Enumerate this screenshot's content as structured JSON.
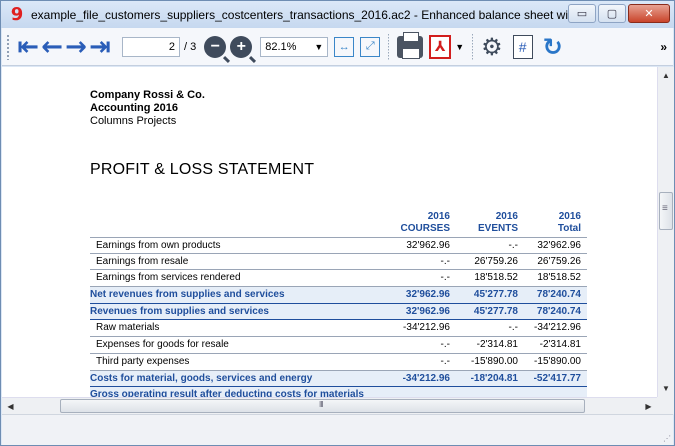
{
  "window": {
    "title": "example_file_customers_suppliers_costcenters_transactions_2016.ac2 - Enhanced balance sheet with g...",
    "app_icon": "9"
  },
  "toolbar": {
    "page_current": "2",
    "page_total": "/ 3",
    "zoom": "82.1%"
  },
  "document": {
    "company": "Company Rossi & Co.",
    "subtitle": "Accounting 2016",
    "columns": "Columns Projects",
    "title": "PROFIT & LOSS STATEMENT",
    "col_headers": [
      {
        "year": "2016",
        "name": "COURSES"
      },
      {
        "year": "2016",
        "name": "EVENTS"
      },
      {
        "year": "2016",
        "name": "Total"
      }
    ],
    "rows": [
      {
        "label": "Earnings from own products",
        "v1": "32'962.96",
        "v2": "-.-",
        "v3": "32'962.96",
        "total": false
      },
      {
        "label": "Earnings from resale",
        "v1": "-.-",
        "v2": "26'759.26",
        "v3": "26'759.26",
        "total": false
      },
      {
        "label": "Earnings from services rendered",
        "v1": "-.-",
        "v2": "18'518.52",
        "v3": "18'518.52",
        "total": false
      },
      {
        "label": "Net revenues from supplies and services",
        "v1": "32'962.96",
        "v2": "45'277.78",
        "v3": "78'240.74",
        "total": true
      },
      {
        "label": "Revenues from supplies and services",
        "v1": "32'962.96",
        "v2": "45'277.78",
        "v3": "78'240.74",
        "total": true
      },
      {
        "label": "Raw materials",
        "v1": "-34'212.96",
        "v2": "-.-",
        "v3": "-34'212.96",
        "total": false
      },
      {
        "label": "Expenses for goods for resale",
        "v1": "-.-",
        "v2": "-2'314.81",
        "v3": "-2'314.81",
        "total": false
      },
      {
        "label": "Third party expenses",
        "v1": "-.-",
        "v2": "-15'890.00",
        "v3": "-15'890.00",
        "total": false
      },
      {
        "label": "Costs for material, goods, services and energy",
        "v1": "-34'212.96",
        "v2": "-18'204.81",
        "v3": "-52'417.77",
        "total": true
      },
      {
        "label": "Gross operating result after deducting costs for materials",
        "v1": "",
        "v2": "",
        "v3": "",
        "total": true
      }
    ]
  }
}
